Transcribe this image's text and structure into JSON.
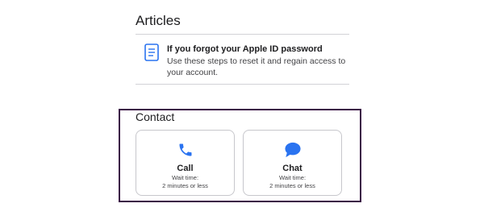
{
  "articles": {
    "heading": "Articles",
    "items": [
      {
        "title": "If you forgot your Apple ID password",
        "description": "Use these steps to reset it and regain access to your account.",
        "icon": "document-icon"
      }
    ]
  },
  "contact": {
    "heading": "Contact",
    "options": [
      {
        "label": "Call",
        "wait_label": "Wait time:",
        "wait_value": "2 minutes or less",
        "icon": "phone-icon"
      },
      {
        "label": "Chat",
        "wait_label": "Wait time:",
        "wait_value": "2 minutes or less",
        "icon": "chat-bubble-icon"
      }
    ]
  },
  "colors": {
    "accent": "#2a73f0",
    "highlight_border": "#3a1045",
    "divider": "#d2d2d7",
    "card_border": "#c7c7cc"
  }
}
